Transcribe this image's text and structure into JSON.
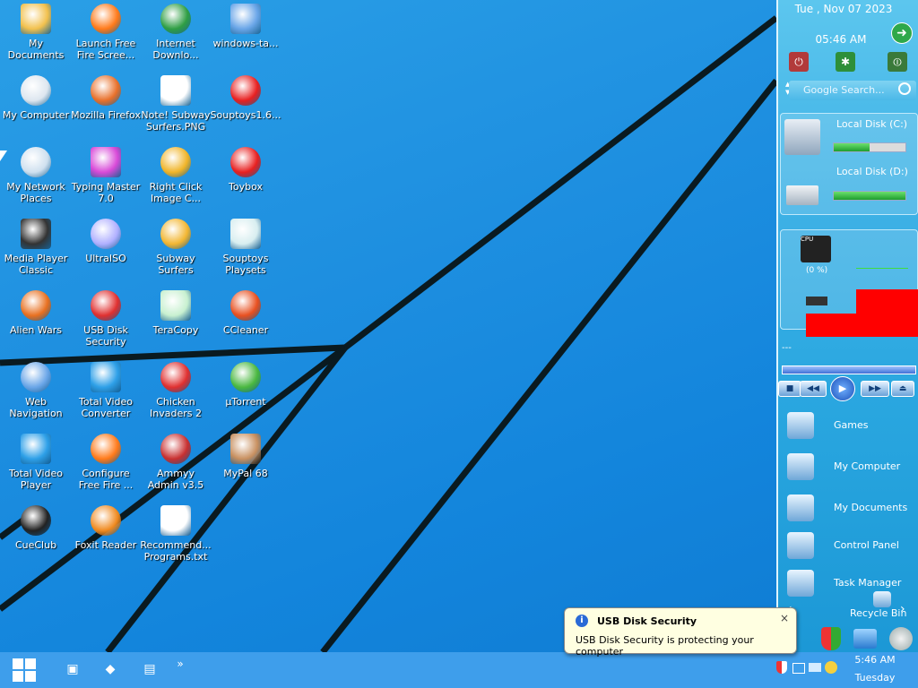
{
  "desktop": {
    "icons": [
      {
        "label": "My Documents",
        "icon": "folder-documents-icon"
      },
      {
        "label": "Launch Free Fire Scree...",
        "icon": "fire-icon"
      },
      {
        "label": "Internet Downlo...",
        "icon": "internet-download-manager-icon"
      },
      {
        "label": "windows-ta...",
        "icon": "screenshot-file-icon"
      },
      {
        "label": "My Computer",
        "icon": "computer-icon"
      },
      {
        "label": "Mozilla Firefox",
        "icon": "firefox-icon"
      },
      {
        "label": "Note! Subway Surfers.PNG",
        "icon": "image-file-icon"
      },
      {
        "label": "Souptoys1.6...",
        "icon": "souptoys-icon"
      },
      {
        "label": "My Network Places",
        "icon": "network-places-icon"
      },
      {
        "label": "Typing Master 7.0",
        "icon": "typing-master-icon"
      },
      {
        "label": "Right Click Image C...",
        "icon": "image-converter-icon"
      },
      {
        "label": "Toybox",
        "icon": "souptoys-icon"
      },
      {
        "label": "Media Player Classic",
        "icon": "media-player-classic-icon"
      },
      {
        "label": "UltraISO",
        "icon": "disc-icon"
      },
      {
        "label": "Subway Surfers",
        "icon": "subway-surfers-icon"
      },
      {
        "label": "Souptoys Playsets",
        "icon": "playsets-icon"
      },
      {
        "label": "Alien Wars",
        "icon": "alien-wars-icon"
      },
      {
        "label": "USB Disk Security",
        "icon": "shield-icon"
      },
      {
        "label": "TeraCopy",
        "icon": "teracopy-icon"
      },
      {
        "label": "CCleaner",
        "icon": "ccleaner-icon"
      },
      {
        "label": "Web Navigation",
        "icon": "globe-icon"
      },
      {
        "label": "Total Video Converter",
        "icon": "video-converter-icon"
      },
      {
        "label": "Chicken Invaders 2",
        "icon": "chicken-icon"
      },
      {
        "label": "µTorrent",
        "icon": "utorrent-icon"
      },
      {
        "label": "Total Video Player",
        "icon": "video-player-icon"
      },
      {
        "label": "Configure Free Fire ...",
        "icon": "fire-icon"
      },
      {
        "label": "Ammyy Admin v3.5",
        "icon": "ammyy-icon"
      },
      {
        "label": "MyPal 68",
        "icon": "mypal-icon"
      },
      {
        "label": "CueClub",
        "icon": "cueclub-icon"
      },
      {
        "label": "Foxit Reader",
        "icon": "foxit-icon"
      },
      {
        "label": "Recommend... Programs.txt",
        "icon": "text-file-icon"
      }
    ]
  },
  "sidebar": {
    "date": "Tue , Nov 07 2023",
    "time": "05:46 AM",
    "search_placeholder": "Google Search...",
    "disk_c": {
      "label": "Local Disk (C:)",
      "used_fraction": 0.5
    },
    "disk_d": {
      "label": "Local Disk (D:)",
      "used_fraction": 1.0
    },
    "cpu": {
      "label": "CPU",
      "percent_text": "(0 %)"
    },
    "player_title": "---",
    "menu": [
      {
        "label": "Games",
        "icon": "games-folder-icon"
      },
      {
        "label": "My Computer",
        "icon": "computer-icon"
      },
      {
        "label": "My Documents",
        "icon": "folder-documents-icon"
      },
      {
        "label": "Control Panel",
        "icon": "control-panel-icon"
      },
      {
        "label": "Task Manager",
        "icon": "task-manager-icon"
      },
      {
        "label": "Recycle Bin",
        "icon": "recycle-bin-icon"
      }
    ]
  },
  "balloon": {
    "title": "USB Disk Security",
    "message": "USB Disk Security is protecting your computer",
    "close": "×"
  },
  "taskbar": {
    "time": "5:46 AM",
    "day": "Tuesday",
    "overflow": "»"
  },
  "colors": {
    "desktop_bg": "#1e8fe0",
    "taskbar": "#3e9eeb",
    "balloon_bg": "#ffffe1",
    "red_block": "#ff0000"
  }
}
